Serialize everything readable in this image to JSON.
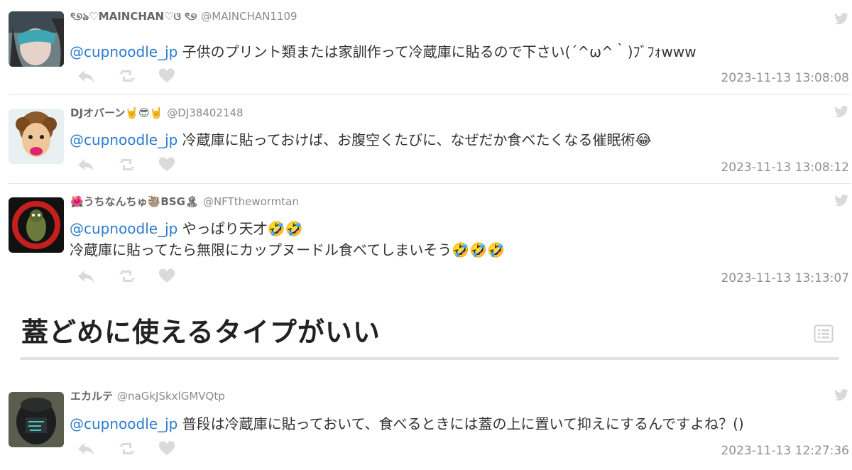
{
  "tweets": [
    {
      "name": "ৎ୭ঌ♡MAINCHAN♡ଓ ৎ୭",
      "handle": "@MAINCHAN1109",
      "mention": "@cupnoodle_jp",
      "line1": " 子供のプリント類または家訓作って冷蔵庫に貼るので下さい(´^ω^｀)ﾌﾞﾌｫwww",
      "line2": "",
      "time": "2023-11-13 13:08:08",
      "avatar_icon": "mask-portrait-avatar"
    },
    {
      "name": "DJオバーン🤘😎🤘",
      "handle": "@DJ38402148",
      "mention": "@cupnoodle_jp",
      "line1": " 冷蔵庫に貼っておけば、お腹空くたびに、なぜだか食べたくなる催眠術😂",
      "line2": "",
      "time": "2023-11-13 13:08:12",
      "avatar_icon": "cartoon-face-avatar"
    },
    {
      "name": "🌺うちなんちゅ🦥BSG🏝",
      "handle": "@NFTthewormtan",
      "mention": "@cupnoodle_jp",
      "line1": " やっぱり天才🤣🤣",
      "line2": "冷蔵庫に貼ってたら無限にカップヌードル食べてしまいそう🤣🤣🤣",
      "time": "2023-11-13 13:13:07",
      "avatar_icon": "red-worm-avatar"
    },
    {
      "name": "エカルテ",
      "handle": "@naGkJSkxlGMVQtp",
      "mention": "@cupnoodle_jp",
      "line1": " 普段は冷蔵庫に貼っておいて、食べるときには蓋の上に置いて抑えにするんですよね？()",
      "line2": "",
      "time": "2023-11-13 12:27:36",
      "avatar_icon": "dark-figure-avatar"
    }
  ],
  "section_heading": "蓋どめに使えるタイプがいい",
  "icons": {
    "reply": "reply-icon",
    "retweet": "retweet-icon",
    "like": "heart-icon",
    "source": "twitter-bird-icon",
    "list": "list-icon"
  },
  "colors": {
    "mention": "#2b7bd0",
    "muted": "#8f8f8f",
    "icon": "#d9d9d9"
  }
}
